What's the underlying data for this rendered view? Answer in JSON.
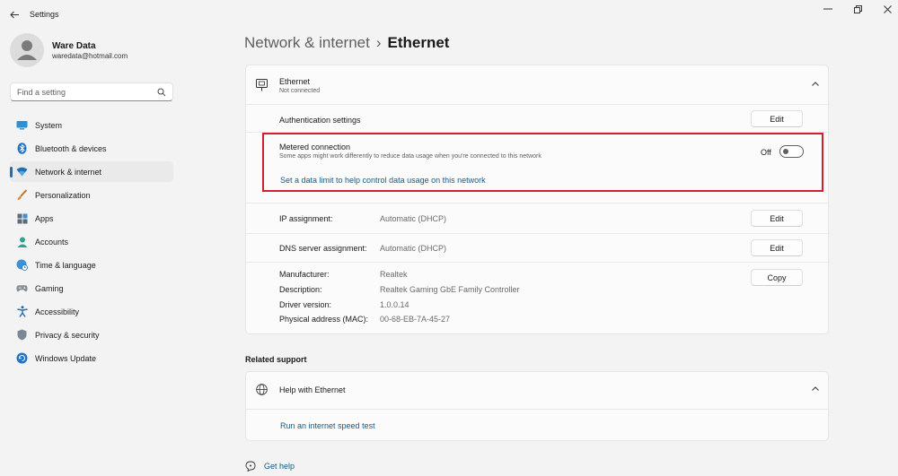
{
  "app": {
    "title": "Settings"
  },
  "profile": {
    "name": "Ware Data",
    "email": "waredata@hotmail.com"
  },
  "search": {
    "placeholder": "Find a setting"
  },
  "sidebar": {
    "items": [
      {
        "label": "System",
        "icon": "monitor-icon"
      },
      {
        "label": "Bluetooth & devices",
        "icon": "bluetooth-icon"
      },
      {
        "label": "Network & internet",
        "icon": "wifi-icon",
        "active": true
      },
      {
        "label": "Personalization",
        "icon": "brush-icon"
      },
      {
        "label": "Apps",
        "icon": "apps-icon"
      },
      {
        "label": "Accounts",
        "icon": "person-icon"
      },
      {
        "label": "Time & language",
        "icon": "globe-clock-icon"
      },
      {
        "label": "Gaming",
        "icon": "gamepad-icon"
      },
      {
        "label": "Accessibility",
        "icon": "accessibility-icon"
      },
      {
        "label": "Privacy & security",
        "icon": "shield-icon"
      },
      {
        "label": "Windows Update",
        "icon": "update-icon"
      }
    ]
  },
  "breadcrumb": {
    "parent": "Network & internet",
    "separator": "›",
    "current": "Ethernet"
  },
  "ethernet": {
    "title": "Ethernet",
    "status": "Not connected",
    "auth_label": "Authentication settings",
    "auth_button": "Edit",
    "metered": {
      "title": "Metered connection",
      "description": "Some apps might work differently to reduce data usage when you're connected to this network",
      "toggle_state": "Off",
      "link": "Set a data limit to help control data usage on this network"
    },
    "ip": {
      "label": "IP assignment:",
      "value": "Automatic (DHCP)",
      "button": "Edit"
    },
    "dns": {
      "label": "DNS server assignment:",
      "value": "Automatic (DHCP)",
      "button": "Edit"
    },
    "props": [
      {
        "label": "Manufacturer:",
        "value": "Realtek"
      },
      {
        "label": "Description:",
        "value": "Realtek Gaming GbE Family Controller"
      },
      {
        "label": "Driver version:",
        "value": "1.0.0.14"
      },
      {
        "label": "Physical address (MAC):",
        "value": "00-68-EB-7A-45-27"
      }
    ],
    "copy_button": "Copy"
  },
  "related": {
    "title": "Related support",
    "help_title": "Help with Ethernet",
    "speed_link": "Run an internet speed test"
  },
  "footer": {
    "get_help": "Get help"
  },
  "colors": {
    "accent": "#1f6fb4",
    "link": "#0f5c8c",
    "highlight": "#d0212a"
  }
}
